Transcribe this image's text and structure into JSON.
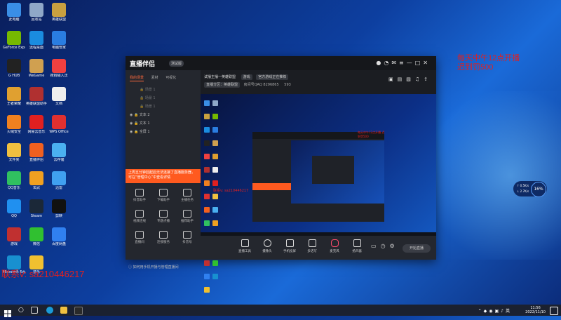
{
  "desktop": {
    "icons": [
      {
        "label": "此电脑",
        "color": "#3a8ee6"
      },
      {
        "label": "回收站",
        "color": "#8fa8c8"
      },
      {
        "label": "英雄联盟",
        "color": "#c8a040"
      },
      {
        "label": "GeForce Experience",
        "color": "#76b900"
      },
      {
        "label": "远程桌面",
        "color": "#1a8ce0"
      },
      {
        "label": "电脑管家",
        "color": "#2a7de1"
      },
      {
        "label": "G HUB",
        "color": "#222"
      },
      {
        "label": "WeGame",
        "color": "#d0a050"
      },
      {
        "label": "搜狗输入法",
        "color": "#f04040"
      },
      {
        "label": "王者荣耀",
        "color": "#e0a030"
      },
      {
        "label": "英雄联盟助手",
        "color": "#b03030"
      },
      {
        "label": "文档",
        "color": "#eee"
      },
      {
        "label": "火绒安全",
        "color": "#f08020"
      },
      {
        "label": "网易云音乐",
        "color": "#e02020"
      },
      {
        "label": "WPS Office",
        "color": "#e03030"
      },
      {
        "label": "文件夹",
        "color": "#f0c040"
      },
      {
        "label": "直播伴侣",
        "color": "#f06020"
      },
      {
        "label": "云存储",
        "color": "#4ab0f0"
      },
      {
        "label": "QQ音乐",
        "color": "#30c060"
      },
      {
        "label": "玄武",
        "color": "#f0a020"
      },
      {
        "label": "迅雷",
        "color": "#40a0f0"
      },
      {
        "label": "QQ",
        "color": "#2090f0"
      },
      {
        "label": "Steam",
        "color": "#1b2838"
      },
      {
        "label": "剪映",
        "color": "#111"
      },
      {
        "label": "游戏",
        "color": "#c03030"
      },
      {
        "label": "微信",
        "color": "#30c030"
      },
      {
        "label": "百度网盘",
        "color": "#3080f0"
      },
      {
        "label": "Microsoft Edge",
        "color": "#1890d0"
      },
      {
        "label": "音乐",
        "color": "#f0c030"
      }
    ]
  },
  "overlay_text": {
    "right_line1": "每天中午12点开播",
    "right_line2": "迟到罚500",
    "bottom_left": "联系v: sa210446217"
  },
  "app": {
    "logo": "直播伴侣",
    "badge": "测试版",
    "tabs": [
      "我的场景",
      "素材",
      "可视化"
    ],
    "scenes": [
      "场景 1",
      "场景 1",
      "场景 1",
      "文本 2",
      "文本 1",
      "全屏 1"
    ],
    "notice": "上周五分钟回起后无法连接了直播服务器，可在“管理中心”中查看详情",
    "tools": [
      "抖音助手",
      "下载助手",
      "主播任务",
      "视频连线",
      "专题点播",
      "推荐助手",
      "直播间",
      "连接服务",
      "抖音号"
    ],
    "help": "如何用手机开播与管理直播间",
    "room_title": "试播主播一英雄联盟",
    "room_tag": "游戏",
    "room_desc": "官方游戏正在推荐",
    "stats": [
      "直播分区：英雄联盟",
      "房间号QAQ 8296865",
      "593"
    ],
    "nested_red": "每天中午12点开播 迟到罚500",
    "preview_watermark": "联系v: sa210446217",
    "bottom": [
      "直播工具",
      "摄像头",
      "手机投屏",
      "多话写",
      "麦克风",
      "扬声器"
    ],
    "start_button": "开始直播"
  },
  "widget": {
    "percent": "16%",
    "up": "0.5K/s",
    "down": "2.7K/s"
  },
  "taskbar": {
    "time": "11:56",
    "date": "2022/11/10"
  }
}
